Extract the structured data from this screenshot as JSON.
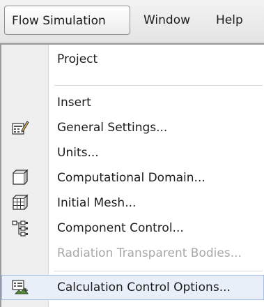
{
  "menubar": {
    "items": [
      {
        "label": "Flow Simulation",
        "active": true
      },
      {
        "label": "Window",
        "active": false
      },
      {
        "label": "Help",
        "active": false
      }
    ]
  },
  "menu": {
    "items": [
      {
        "label": "Project",
        "icon": null,
        "enabled": true
      },
      {
        "label": "Insert",
        "icon": null,
        "enabled": true
      },
      {
        "label": "General Settings...",
        "icon": "general-settings-icon",
        "enabled": true
      },
      {
        "label": "Units...",
        "icon": null,
        "enabled": true
      },
      {
        "label": "Computational Domain...",
        "icon": "computational-domain-icon",
        "enabled": true
      },
      {
        "label": "Initial Mesh...",
        "icon": "initial-mesh-icon",
        "enabled": true
      },
      {
        "label": "Component Control...",
        "icon": "component-control-icon",
        "enabled": true
      },
      {
        "label": "Radiation Transparent Bodies...",
        "icon": null,
        "enabled": false
      },
      {
        "label": "Calculation Control Options...",
        "icon": "calculation-control-icon",
        "enabled": true,
        "highlighted": true
      }
    ]
  },
  "colors": {
    "highlight_bg": "#e9eff8",
    "highlight_border": "#a9bfe0",
    "disabled_text": "#a8a8a8",
    "gutter_bg": "#efefef"
  }
}
